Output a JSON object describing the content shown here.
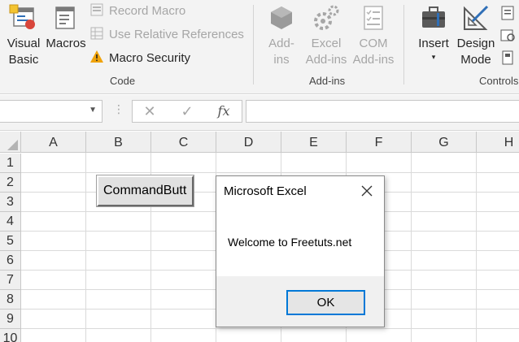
{
  "ribbon": {
    "visual_basic_label": "Visual\nBasic",
    "macros_label": "Macros",
    "record_macro_label": "Record Macro",
    "relative_refs_label": "Use Relative References",
    "macro_security_label": "Macro Security",
    "code_group_label": "Code",
    "addins_label": "Add-\nins",
    "excel_addins_label": "Excel\nAdd-ins",
    "com_addins_label": "COM\nAdd-ins",
    "addins_group_label": "Add-ins",
    "insert_label": "Insert",
    "design_mode_label": "Design\nMode",
    "controls_group_label": "Controls"
  },
  "formula_bar": {
    "cancel_glyph": "✕",
    "enter_glyph": "✓",
    "fx_glyph": "fx"
  },
  "grid": {
    "columns": [
      "A",
      "B",
      "C",
      "D",
      "E",
      "F",
      "G",
      "H"
    ],
    "rows": [
      "1",
      "2",
      "3",
      "4",
      "5",
      "6",
      "7",
      "8",
      "9",
      "10"
    ]
  },
  "command_button": {
    "label": "CommandButt"
  },
  "message_box": {
    "title": "Microsoft Excel",
    "message": "Welcome to Freetuts.net",
    "ok_label": "OK"
  },
  "colors": {
    "ribbon_bg": "#f3f3f3",
    "disabled_text": "#a6a6a6",
    "ok_border": "#0078d7",
    "warning": "#f0a30a"
  }
}
